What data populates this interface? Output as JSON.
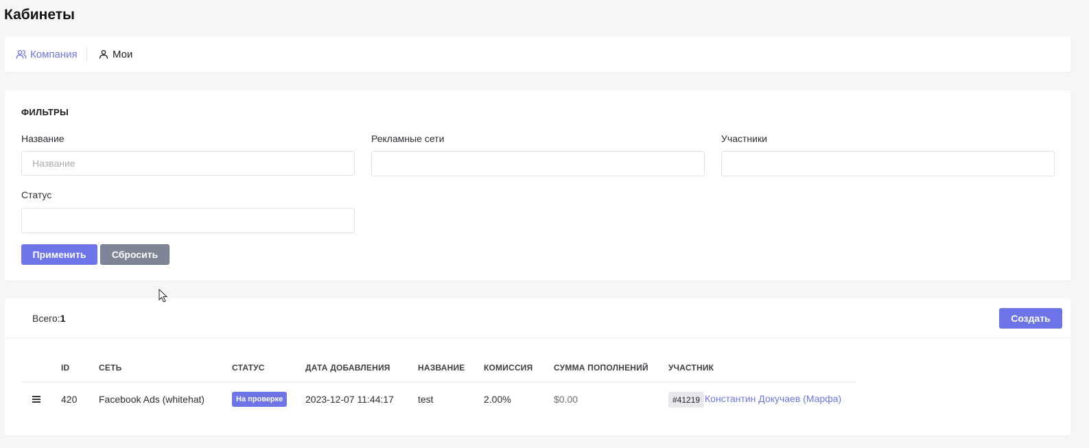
{
  "page": {
    "title": "Кабинеты"
  },
  "tabs": [
    {
      "label": "Компания",
      "icon": "users-icon",
      "active": true
    },
    {
      "label": "Мои",
      "icon": "user-icon",
      "active": false
    }
  ],
  "filters": {
    "title": "ФИЛЬТРЫ",
    "name": {
      "label": "Название",
      "placeholder": "Название",
      "value": ""
    },
    "networks": {
      "label": "Рекламные сети",
      "value": ""
    },
    "participants": {
      "label": "Участники",
      "value": ""
    },
    "status": {
      "label": "Статус",
      "value": ""
    },
    "apply_label": "Применить",
    "reset_label": "Сбросить"
  },
  "table": {
    "total_label": "Всего:",
    "total_count": "1",
    "create_label": "Создать",
    "columns": [
      "ID",
      "СЕТЬ",
      "СТАТУС",
      "ДАТА ДОБАВЛЕНИЯ",
      "НАЗВАНИЕ",
      "КОМИССИЯ",
      "СУММА ПОПОЛНЕНИЙ",
      "УЧАСТНИК"
    ],
    "rows": [
      {
        "id": "420",
        "network": "Facebook Ads (whitehat)",
        "status": "На проверке",
        "date_added": "2023-12-07 11:44:17",
        "name": "test",
        "commission": "2.00%",
        "top_up_sum": "$0.00",
        "participant_id": "#41219",
        "participant_name": "Константин Докучаев (Марфа)"
      }
    ]
  },
  "colors": {
    "accent": "#6c74e8",
    "secondary_button": "#7e8596",
    "background": "#f5f6f8"
  }
}
